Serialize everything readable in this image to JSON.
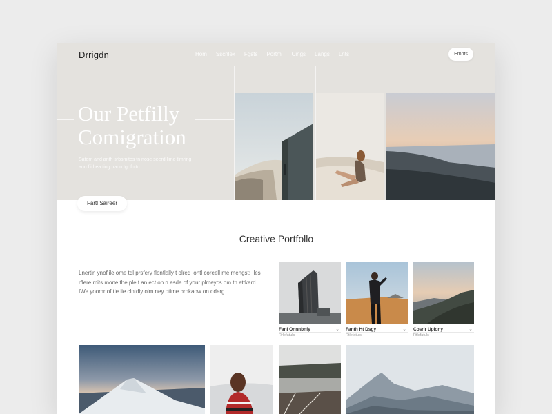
{
  "nav": {
    "logo": "Drrigdn",
    "items": [
      "Hom",
      "Sscnlex",
      "Fgsts",
      "Portml",
      "Cings",
      "Langs",
      "Lnts"
    ],
    "button_label": "Emnts"
  },
  "hero": {
    "title_line1": "Our Petfilly",
    "title_line2": "Comigration",
    "subtitle": "Satem and anth srbsmites tn nose seerd lime tlmring ann fiithea ting naon tgr fuito",
    "cta_label": "Fartl Saireer"
  },
  "portfolio": {
    "title": "Creative Portfollo",
    "description": "Lnertin ynoflile ome tdl prsfery flontlally t olred lontl coreell me mengst: Iles rflere mits mone the ple t an ect on n esde of your plmeycs om th ettkerd IWe yoomr of tle lie clntdiy olm ney ptime brnkaow on oderg.",
    "cards": [
      {
        "caption": "Fanl Onnnbnfy",
        "sub": "Rrlefatuls"
      },
      {
        "caption": "Fanth Ht Dsgy",
        "sub": "Rtlefatuls"
      },
      {
        "caption": "Cosrlr Uplony",
        "sub": "Rtlefatuls"
      }
    ]
  },
  "colors": {
    "hero_bg": "#e4e2de",
    "page_bg": "#ffffff",
    "outer_bg": "#ececec"
  }
}
